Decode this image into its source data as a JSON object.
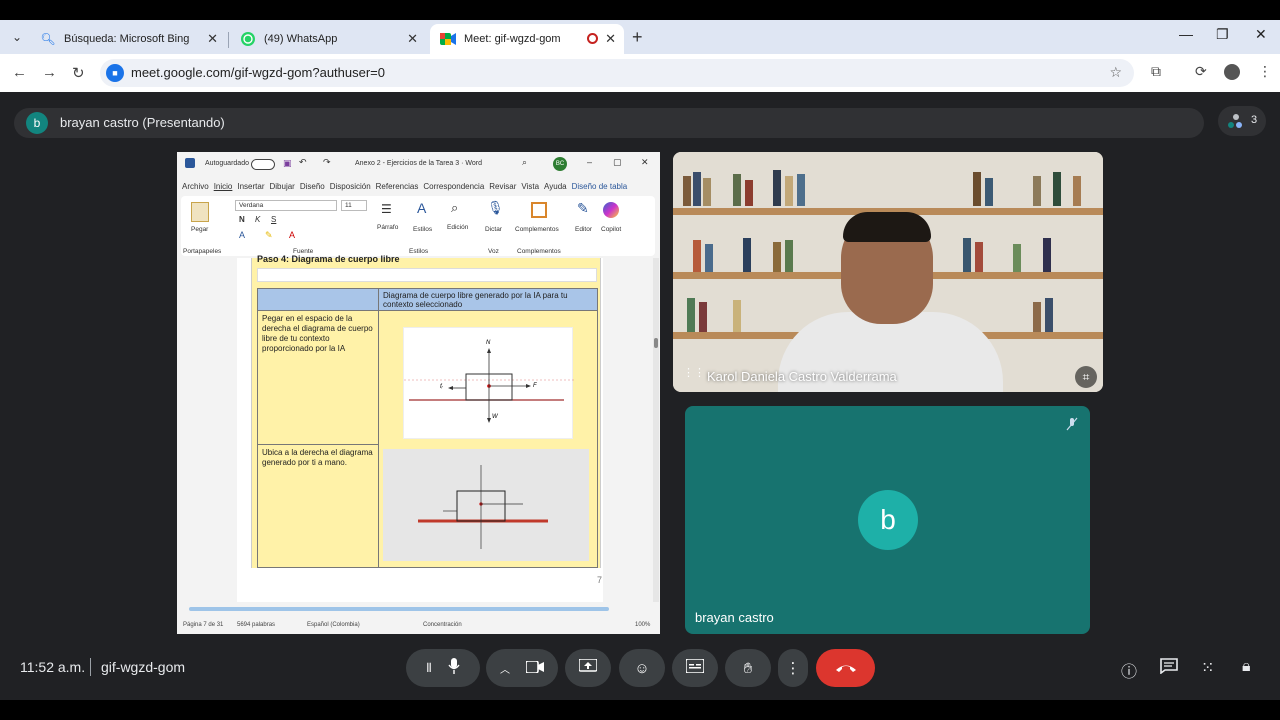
{
  "browser": {
    "tabs": [
      {
        "label": "Búsqueda: Microsoft Bing",
        "icon": "search-icon"
      },
      {
        "label": "(49) WhatsApp",
        "icon": "whatsapp-icon"
      },
      {
        "label": "Meet: gif-wgzd-gom",
        "icon": "meet-icon"
      }
    ],
    "url": "meet.google.com/gif-wgzd-gom?authuser=0"
  },
  "meet": {
    "presenting": "brayan castro (Presentando)",
    "presenter_initial": "b",
    "participant_count": "3",
    "time": "11:52 a.m.",
    "meeting_code": "gif-wgzd-gom",
    "remote_name": "Karol Daniela Castro Valderrama",
    "self_initial": "b",
    "self_name": "brayan castro",
    "end_color": "#dc362e",
    "self_tile_color": "#17736f"
  },
  "word": {
    "autosave": "Autoguardado",
    "doc_title": "Anexo 2 - Ejercicios de la Tarea 3 · Word",
    "user_initials": "BC",
    "menu": [
      "Archivo",
      "Inicio",
      "Insertar",
      "Dibujar",
      "Diseño",
      "Disposición",
      "Referencias",
      "Correspondencia",
      "Revisar",
      "Vista",
      "Ayuda",
      "Diseño de tabla"
    ],
    "font": "Verdana",
    "size": "11",
    "groups": {
      "clipboard": "Portapapeles",
      "font": "Fuente",
      "styles": "Estilos",
      "voice": "Voz",
      "addins": "Complementos"
    },
    "buttons": {
      "paste": "Pegar",
      "paragraph": "Párrafo",
      "styles": "Estilos",
      "edit": "Edición",
      "dictate": "Dictar",
      "addins": "Complementos",
      "editor": "Editor",
      "copilot": "Copilot"
    },
    "heading": "Paso 4: Diagrama de cuerpo libre",
    "table_header": "Diagrama de cuerpo libre generado por la IA para tu contexto seleccionado",
    "row1": "Pegar en el espacio de la derecha el diagrama de cuerpo libre de tu contexto proporcionado por la IA",
    "row2": "Ubica a la derecha el diagrama generado por ti a mano.",
    "page_number": "7",
    "status": {
      "page": "Página 7 de 31",
      "words": "5694 palabras",
      "lang": "Español (Colombia)",
      "focus": "Concentración",
      "zoom": "100%"
    },
    "fbd": {
      "n": "N",
      "w": "W",
      "f": "F",
      "fr": "fᵣ"
    }
  }
}
